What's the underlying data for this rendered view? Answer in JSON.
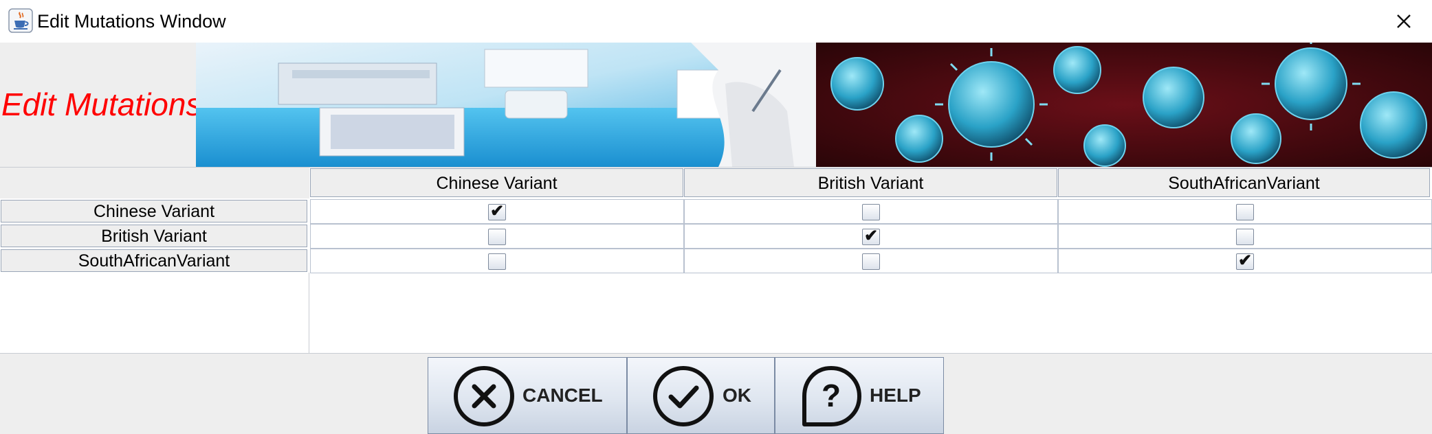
{
  "window": {
    "title": "Edit Mutations Window",
    "app_icon": "java-coffee-cup-icon",
    "close_icon": "close-icon"
  },
  "banner": {
    "title": "Edit Mutations",
    "title_color": "#ff0000",
    "images": [
      "laboratory-image",
      "virus-image"
    ]
  },
  "table": {
    "columns": [
      "Chinese Variant",
      "British Variant",
      "SouthAfricanVariant"
    ],
    "rows": [
      {
        "label": "Chinese Variant",
        "checked": [
          true,
          false,
          false
        ]
      },
      {
        "label": "British Variant",
        "checked": [
          false,
          true,
          false
        ]
      },
      {
        "label": "SouthAfricanVariant",
        "checked": [
          false,
          false,
          true
        ]
      }
    ],
    "checkmark": "✔"
  },
  "buttons": {
    "cancel": {
      "label": "CANCEL",
      "icon": "cancel-x-icon"
    },
    "ok": {
      "label": "OK",
      "icon": "ok-check-icon"
    },
    "help": {
      "label": "HELP",
      "icon": "help-question-icon"
    }
  }
}
